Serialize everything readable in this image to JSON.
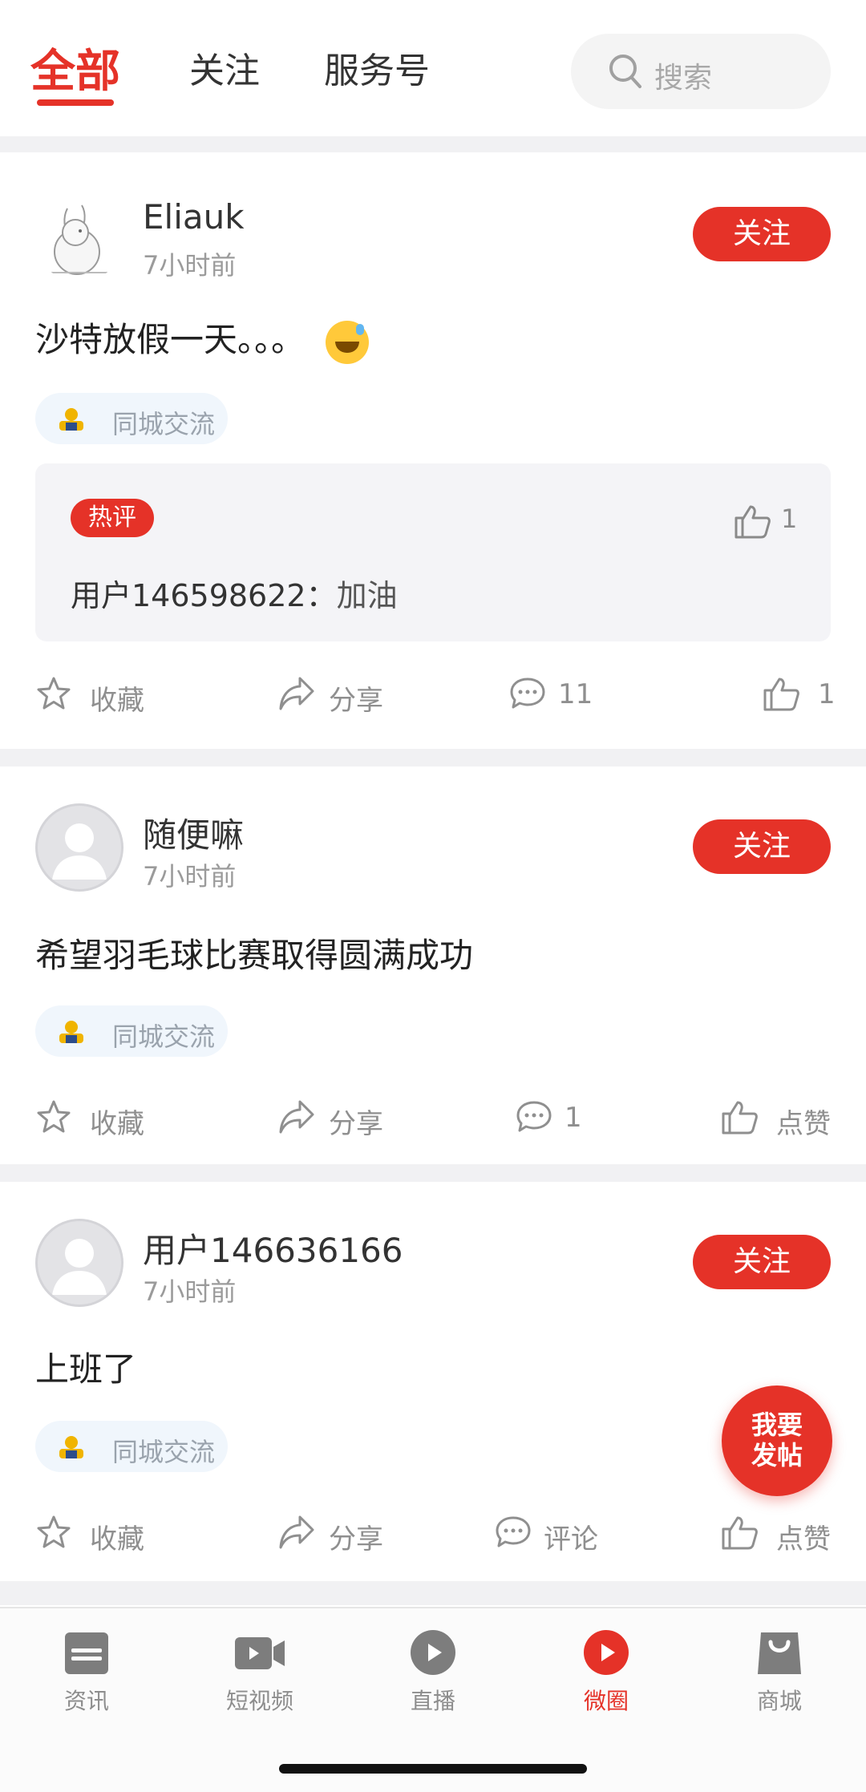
{
  "tabs": {
    "all": "全部",
    "following": "关注",
    "service": "服务号"
  },
  "search": {
    "placeholder": "搜索"
  },
  "posts": [
    {
      "username": "Eliauk",
      "time": "7小时前",
      "follow_label": "关注",
      "content": "沙特放假一天。。。",
      "tag": "同城交流",
      "hot": {
        "badge": "热评",
        "like_count": "1",
        "commenter": "用户146598622：",
        "comment": "加油"
      },
      "actions": {
        "favorite": "收藏",
        "share": "分享",
        "comment": "11",
        "like": "1"
      }
    },
    {
      "username": "随便嘛",
      "time": "7小时前",
      "follow_label": "关注",
      "content": "希望羽毛球比赛取得圆满成功",
      "tag": "同城交流",
      "actions": {
        "favorite": "收藏",
        "share": "分享",
        "comment": "1",
        "like": "点赞"
      }
    },
    {
      "username": "用户146636166",
      "time": "7小时前",
      "follow_label": "关注",
      "content": "上班了",
      "tag": "同城交流",
      "actions": {
        "favorite": "收藏",
        "share": "分享",
        "comment": "评论",
        "like": "点赞"
      }
    }
  ],
  "fab": {
    "line1": "我要",
    "line2": "发帖"
  },
  "bottom_nav": {
    "news": "资讯",
    "short_video": "短视频",
    "live": "直播",
    "circle": "微圈",
    "mall": "商城"
  },
  "colors": {
    "accent": "#e53228",
    "divider": "#f1f1f3"
  }
}
